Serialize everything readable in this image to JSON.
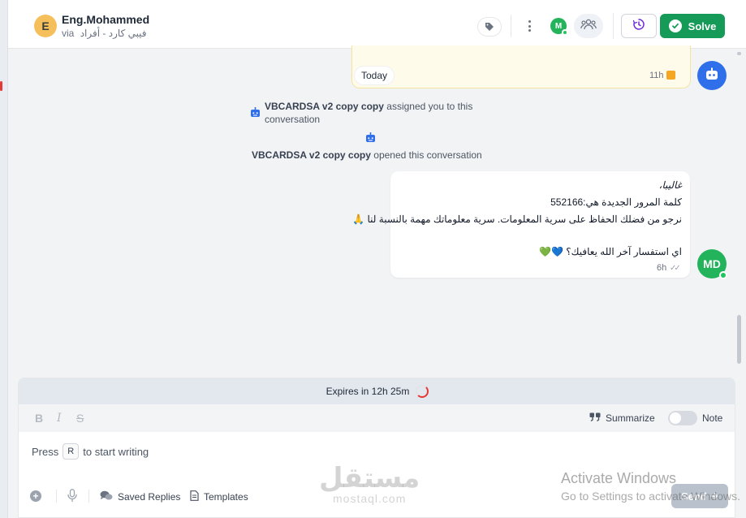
{
  "header": {
    "avatar_initial": "E",
    "contact_name": "Eng.Mohammed",
    "via_label": "via",
    "inbox_name": "فيبي كارد - أفراد",
    "agent_initial": "M",
    "solve_label": "Solve"
  },
  "messages": {
    "note": {
      "date_chip": "Today",
      "time": "11h"
    },
    "activity_assigned": {
      "bot_name": "VBCARDSA v2 copy copy",
      "text": "assigned you to this conversation"
    },
    "activity_opened": {
      "bot_name": "VBCARDSA v2 copy copy",
      "text": "opened this conversation"
    },
    "outgoing": {
      "lines": [
        "غاليبا،",
        "كلمة المرور الجديدة هي:552166",
        "نرجو من فضلك الحفاظ على سرية المعلومات. سرية معلوماتك مهمة بالنسبة لنا 🙏",
        "اي استفسار آخر الله يعافيك؟ 💙💚"
      ],
      "time": "6h",
      "ticks": "✓✓",
      "sender_initials": "MD"
    }
  },
  "reply": {
    "expires": "Expires in 12h 25m",
    "format_bold": "B",
    "format_italic": "I",
    "format_strike": "S",
    "summarize": "Summarize",
    "note_toggle_label": "Note",
    "prompt_prefix": "Press",
    "prompt_key": "R",
    "prompt_suffix": "to start writing",
    "saved_replies": "Saved Replies",
    "templates": "Templates",
    "send": "Send"
  },
  "overlay": {
    "watermark_ar": "مستقل",
    "watermark_en": "mostaql.com",
    "activate_title": "Activate Windows",
    "activate_sub": "Go to Settings to activate Windows."
  },
  "colors": {
    "solve": "#169a57",
    "bot_avatar": "#2f6fea",
    "agent_avatar": "#22b35b",
    "note_bg": "#fffbea"
  }
}
